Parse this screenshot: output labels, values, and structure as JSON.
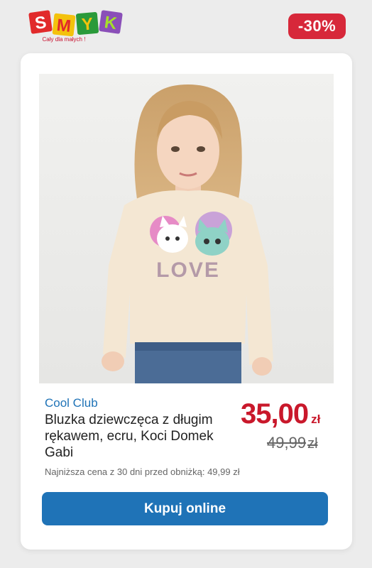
{
  "brand_logo": {
    "letters": [
      "S",
      "M",
      "Y",
      "K"
    ],
    "tagline": "Cały dla małych !"
  },
  "discount_badge": "-30%",
  "product": {
    "brand": "Cool Club",
    "title": "Bluzka dziewczęca z długim rękawem, ecru, Koci Domek Gabi",
    "price": "35,00",
    "currency": "zł",
    "old_price": "49,99",
    "old_currency": "zł",
    "lowest_price_note": "Najniższa cena z 30 dni przed obniżką: 49,99 zł",
    "print_text": "LOVE"
  },
  "cta": {
    "label": "Kupuj online"
  },
  "colors": {
    "accent_blue": "#1f73b7",
    "sale_red": "#c9182b",
    "badge_red": "#d7283a"
  }
}
